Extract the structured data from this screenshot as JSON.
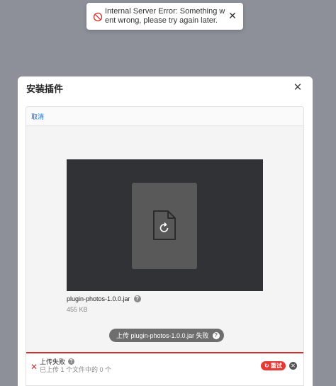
{
  "toast": {
    "message": "Internal Server Error: Something went wrong, please try again later.",
    "icon": "error-circle-icon",
    "close_glyph": "✕"
  },
  "modal": {
    "title": "安装插件",
    "close_glyph": "✕"
  },
  "dashboard": {
    "cancel_label": "取消",
    "file": {
      "name": "plugin-photos-1.0.0.jar",
      "size": "455 KB",
      "help_glyph": "?"
    },
    "fail_pill": {
      "text": "上传 plugin-photos-1.0.0.jar 失败",
      "help_glyph": "?"
    },
    "status": {
      "x_glyph": "✕",
      "title": "上传失败",
      "help_glyph": "?",
      "subtitle": "已上传 1 个文件中的 0 个",
      "retry_label": "重试",
      "retry_glyph": "↻",
      "cancel_glyph": "✕"
    }
  },
  "colors": {
    "backdrop": "#8d9099",
    "error": "#d32f2f",
    "link": "#1269cf",
    "preview_bg": "#313236"
  }
}
